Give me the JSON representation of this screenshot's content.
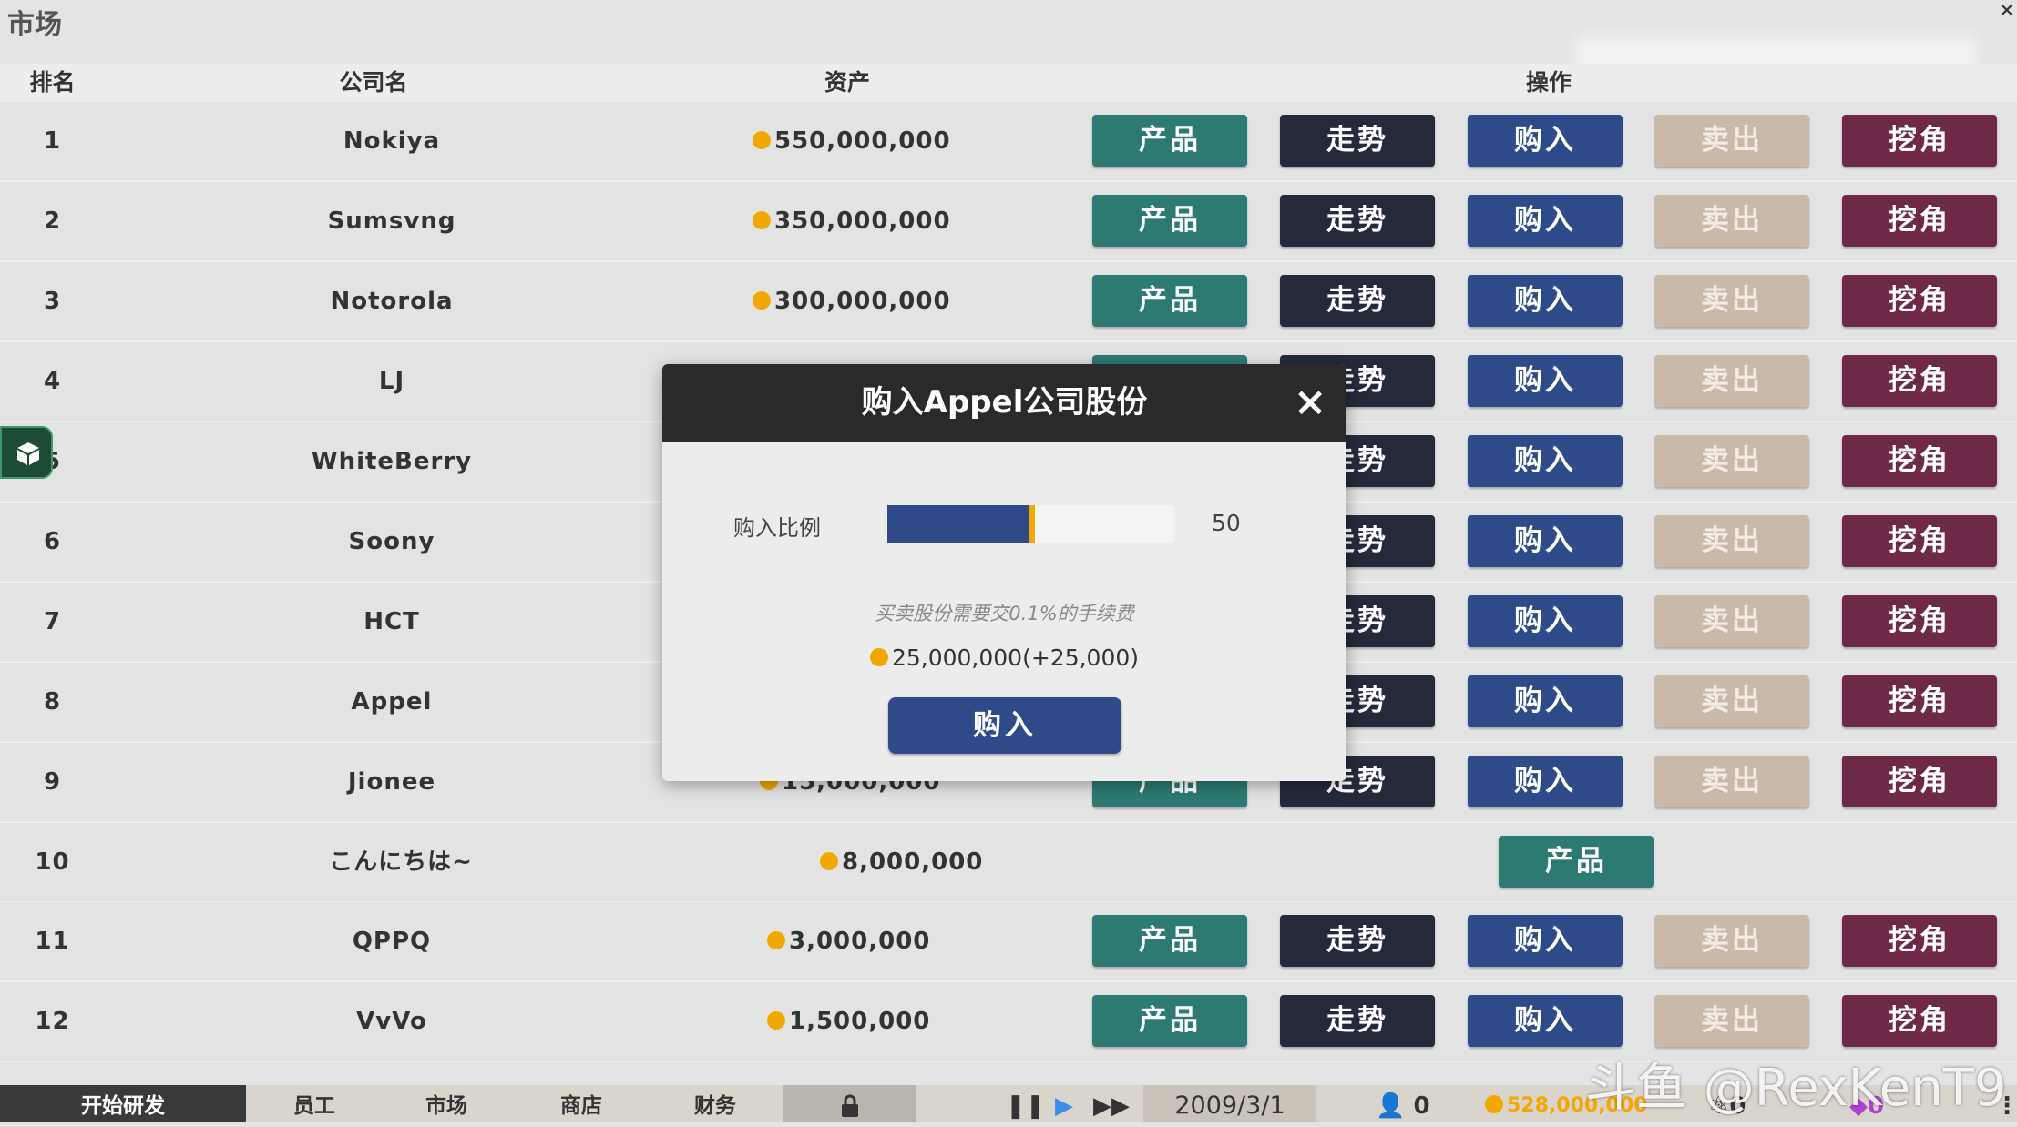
{
  "window": {
    "title": "市场"
  },
  "table": {
    "headers": {
      "rank": "排名",
      "name": "公司名",
      "assets": "资产",
      "actions": "操作"
    },
    "buttons": {
      "product": "产品",
      "trend": "走势",
      "buy": "购入",
      "sell": "卖出",
      "poach": "挖角"
    },
    "rows": [
      {
        "rank": "1",
        "name": "Nokiya",
        "assets": "550,000,000"
      },
      {
        "rank": "2",
        "name": "Sumsvng",
        "assets": "350,000,000"
      },
      {
        "rank": "3",
        "name": "Notorola",
        "assets": "300,000,000"
      },
      {
        "rank": "4",
        "name": "LJ",
        "assets": ""
      },
      {
        "rank": "5",
        "name": "WhiteBerry",
        "assets": ""
      },
      {
        "rank": "6",
        "name": "Soony",
        "assets": ""
      },
      {
        "rank": "7",
        "name": "HCT",
        "assets": ""
      },
      {
        "rank": "8",
        "name": "Appel",
        "assets": ""
      },
      {
        "rank": "9",
        "name": "Jionee",
        "assets": "15,000,000"
      },
      {
        "rank": "10",
        "name": "こんにちは~",
        "assets": "8,000,000"
      },
      {
        "rank": "11",
        "name": "QPPQ",
        "assets": "3,000,000"
      },
      {
        "rank": "12",
        "name": "VvVo",
        "assets": "1,500,000"
      }
    ]
  },
  "modal": {
    "title": "购入Appel公司股份",
    "ratio_label": "购入比例",
    "ratio_value": "50",
    "ratio_fraction": 0.5,
    "fee_note": "买卖股份需要交0.1%的手续费",
    "cost": "25,000,000(+25,000)",
    "buy_button": "购入"
  },
  "bottom_bar": {
    "tabs": [
      "开始研发",
      "员工",
      "市场",
      "商店",
      "财务"
    ],
    "date": "2009/3/1",
    "employees": "0",
    "money": "528,000,000",
    "research": "0",
    "gems": "0"
  },
  "watermark": "斗鱼 @RexKenT9",
  "colors": {
    "product": "#2d7a72",
    "trend": "#252a3a",
    "buy": "#2e4a89",
    "sell": "#c9b9a9",
    "poach": "#6e2848",
    "coin": "#f2a800"
  }
}
